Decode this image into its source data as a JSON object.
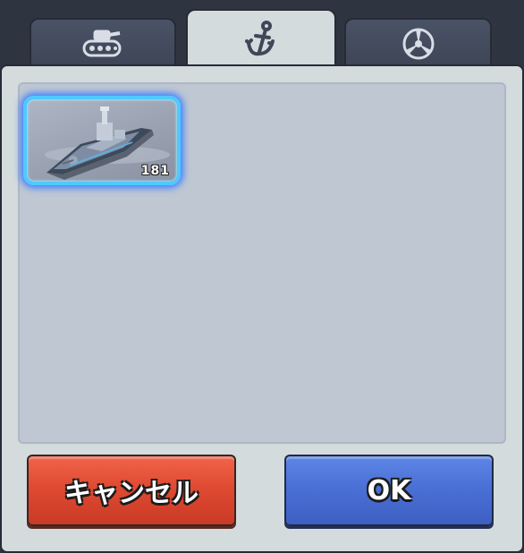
{
  "tabs": [
    {
      "name": "tank",
      "icon": "tank-icon",
      "active": false
    },
    {
      "name": "ship",
      "icon": "anchor-icon",
      "active": true
    },
    {
      "name": "aircraft",
      "icon": "propeller-icon",
      "active": false
    }
  ],
  "unit_card": {
    "image": "warship-image",
    "count": "181",
    "selected": true
  },
  "buttons": {
    "cancel_label": "キャンセル",
    "ok_label": "OK"
  },
  "colors": {
    "selection_glow": "#4fc9ff",
    "cancel_button": "#e04a32",
    "ok_button": "#4a70d6",
    "panel_bg": "#d3dbdd",
    "inner_bg": "#bfc7d3"
  }
}
